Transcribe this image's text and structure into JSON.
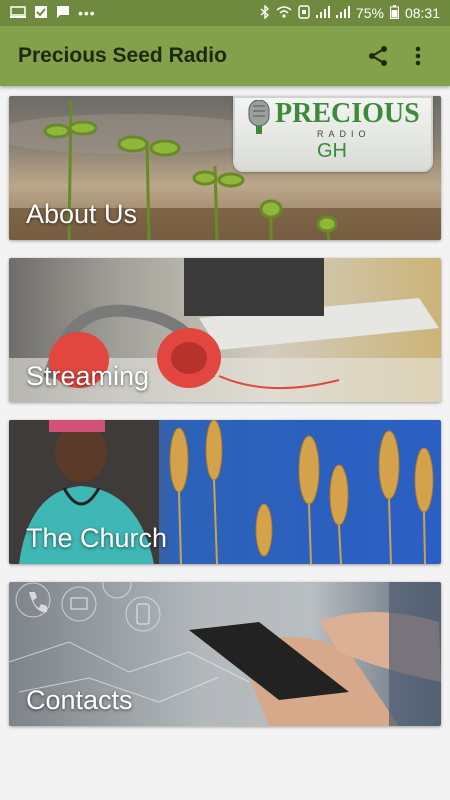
{
  "status_bar": {
    "battery": "75%",
    "time": "08:31",
    "icons": [
      "screenshot-icon",
      "checkbox-icon",
      "message-icon",
      "more-dots-icon",
      "bluetooth-icon",
      "wifi-icon",
      "nfc-icon",
      "signal-icon",
      "signal-icon",
      "battery-icon"
    ]
  },
  "app_bar": {
    "title": "Precious Seed Radio",
    "actions": [
      "share-icon",
      "overflow-menu-icon"
    ],
    "color": "#83a04b"
  },
  "logo": {
    "text": "PRECIOUS",
    "sub": "RADIO",
    "tag": "GH"
  },
  "cards": [
    {
      "label": "About Us"
    },
    {
      "label": "Streaming"
    },
    {
      "label": "The Church"
    },
    {
      "label": "Contacts"
    }
  ]
}
